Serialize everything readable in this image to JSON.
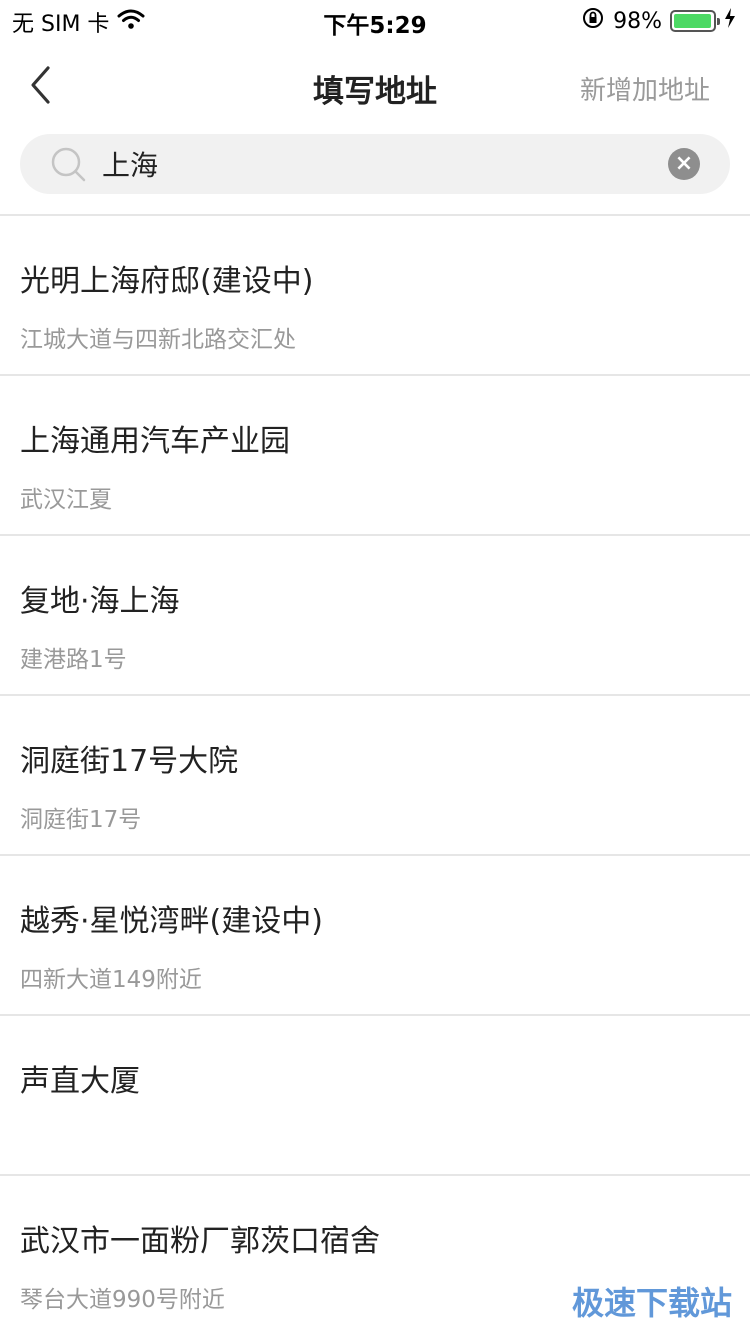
{
  "status_bar": {
    "carrier": "无 SIM 卡",
    "time": "下午5:29",
    "battery_percent": "98%",
    "battery_level": 0.98,
    "icons": [
      "wifi-icon",
      "orientation-lock-icon",
      "battery-icon",
      "charging-icon"
    ]
  },
  "nav": {
    "title": "填写地址",
    "action": "新增加地址"
  },
  "search": {
    "value": "上海",
    "placeholder": ""
  },
  "results": [
    {
      "name": "光明上海府邸(建设中)",
      "address": "江城大道与四新北路交汇处"
    },
    {
      "name": "上海通用汽车产业园",
      "address": "武汉江夏"
    },
    {
      "name": "复地·海上海",
      "address": "建港路1号"
    },
    {
      "name": "洞庭街17号大院",
      "address": "洞庭街17号"
    },
    {
      "name": "越秀·星悦湾畔(建设中)",
      "address": "四新大道149附近"
    },
    {
      "name": "声直大厦",
      "address": ""
    },
    {
      "name": "武汉市一面粉厂郭茨口宿舍",
      "address": "琴台大道990号附近"
    }
  ],
  "watermark": "极速下载站",
  "colors": {
    "battery_green": "#4cd964",
    "secondary_text": "#999999",
    "divider": "#e6e6e6"
  }
}
